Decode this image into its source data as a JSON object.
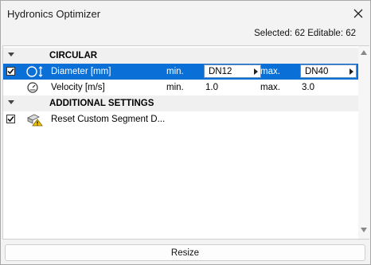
{
  "window": {
    "title": "Hydronics Optimizer",
    "close_icon": "close-icon"
  },
  "info": {
    "status": "Selected: 62 Editable: 62"
  },
  "sections": [
    {
      "label": "CIRCULAR",
      "rows": [
        {
          "checked": true,
          "selected": true,
          "icon": "diameter-icon",
          "name": "Diameter [mm]",
          "min_label": "min.",
          "min_value": "DN12",
          "max_label": "max.",
          "max_value": "DN40"
        },
        {
          "checked": false,
          "selected": false,
          "icon": "velocity-gauge-icon",
          "name": "Velocity [m/s]",
          "min_label": "min.",
          "min_value": "1.0",
          "max_label": "max.",
          "max_value": "3.0"
        }
      ]
    },
    {
      "label": "ADDITIONAL SETTINGS",
      "rows": [
        {
          "checked": true,
          "selected": false,
          "icon": "reset-warning-icon",
          "name": "Reset Custom Segment D..."
        }
      ]
    }
  ],
  "footer": {
    "resize_label": "Resize"
  },
  "colors": {
    "selection": "#0a6fd6",
    "warning": "#f5c400"
  }
}
